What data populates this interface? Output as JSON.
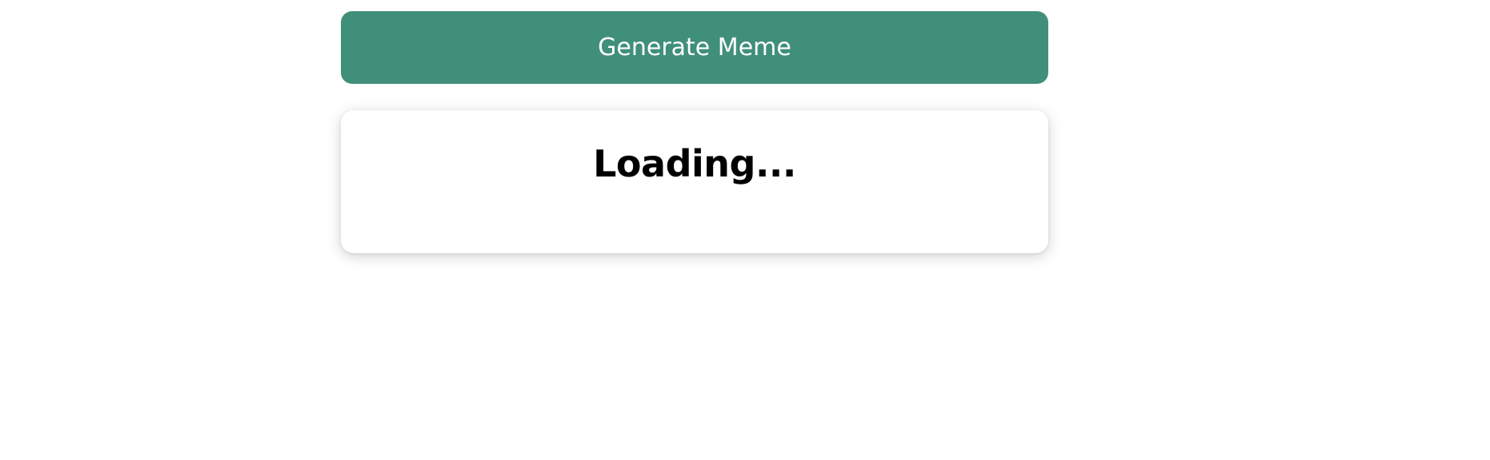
{
  "generator": {
    "button_label": "Generate Meme",
    "button_color": "#408f7b"
  },
  "result": {
    "status_text": "Loading..."
  }
}
